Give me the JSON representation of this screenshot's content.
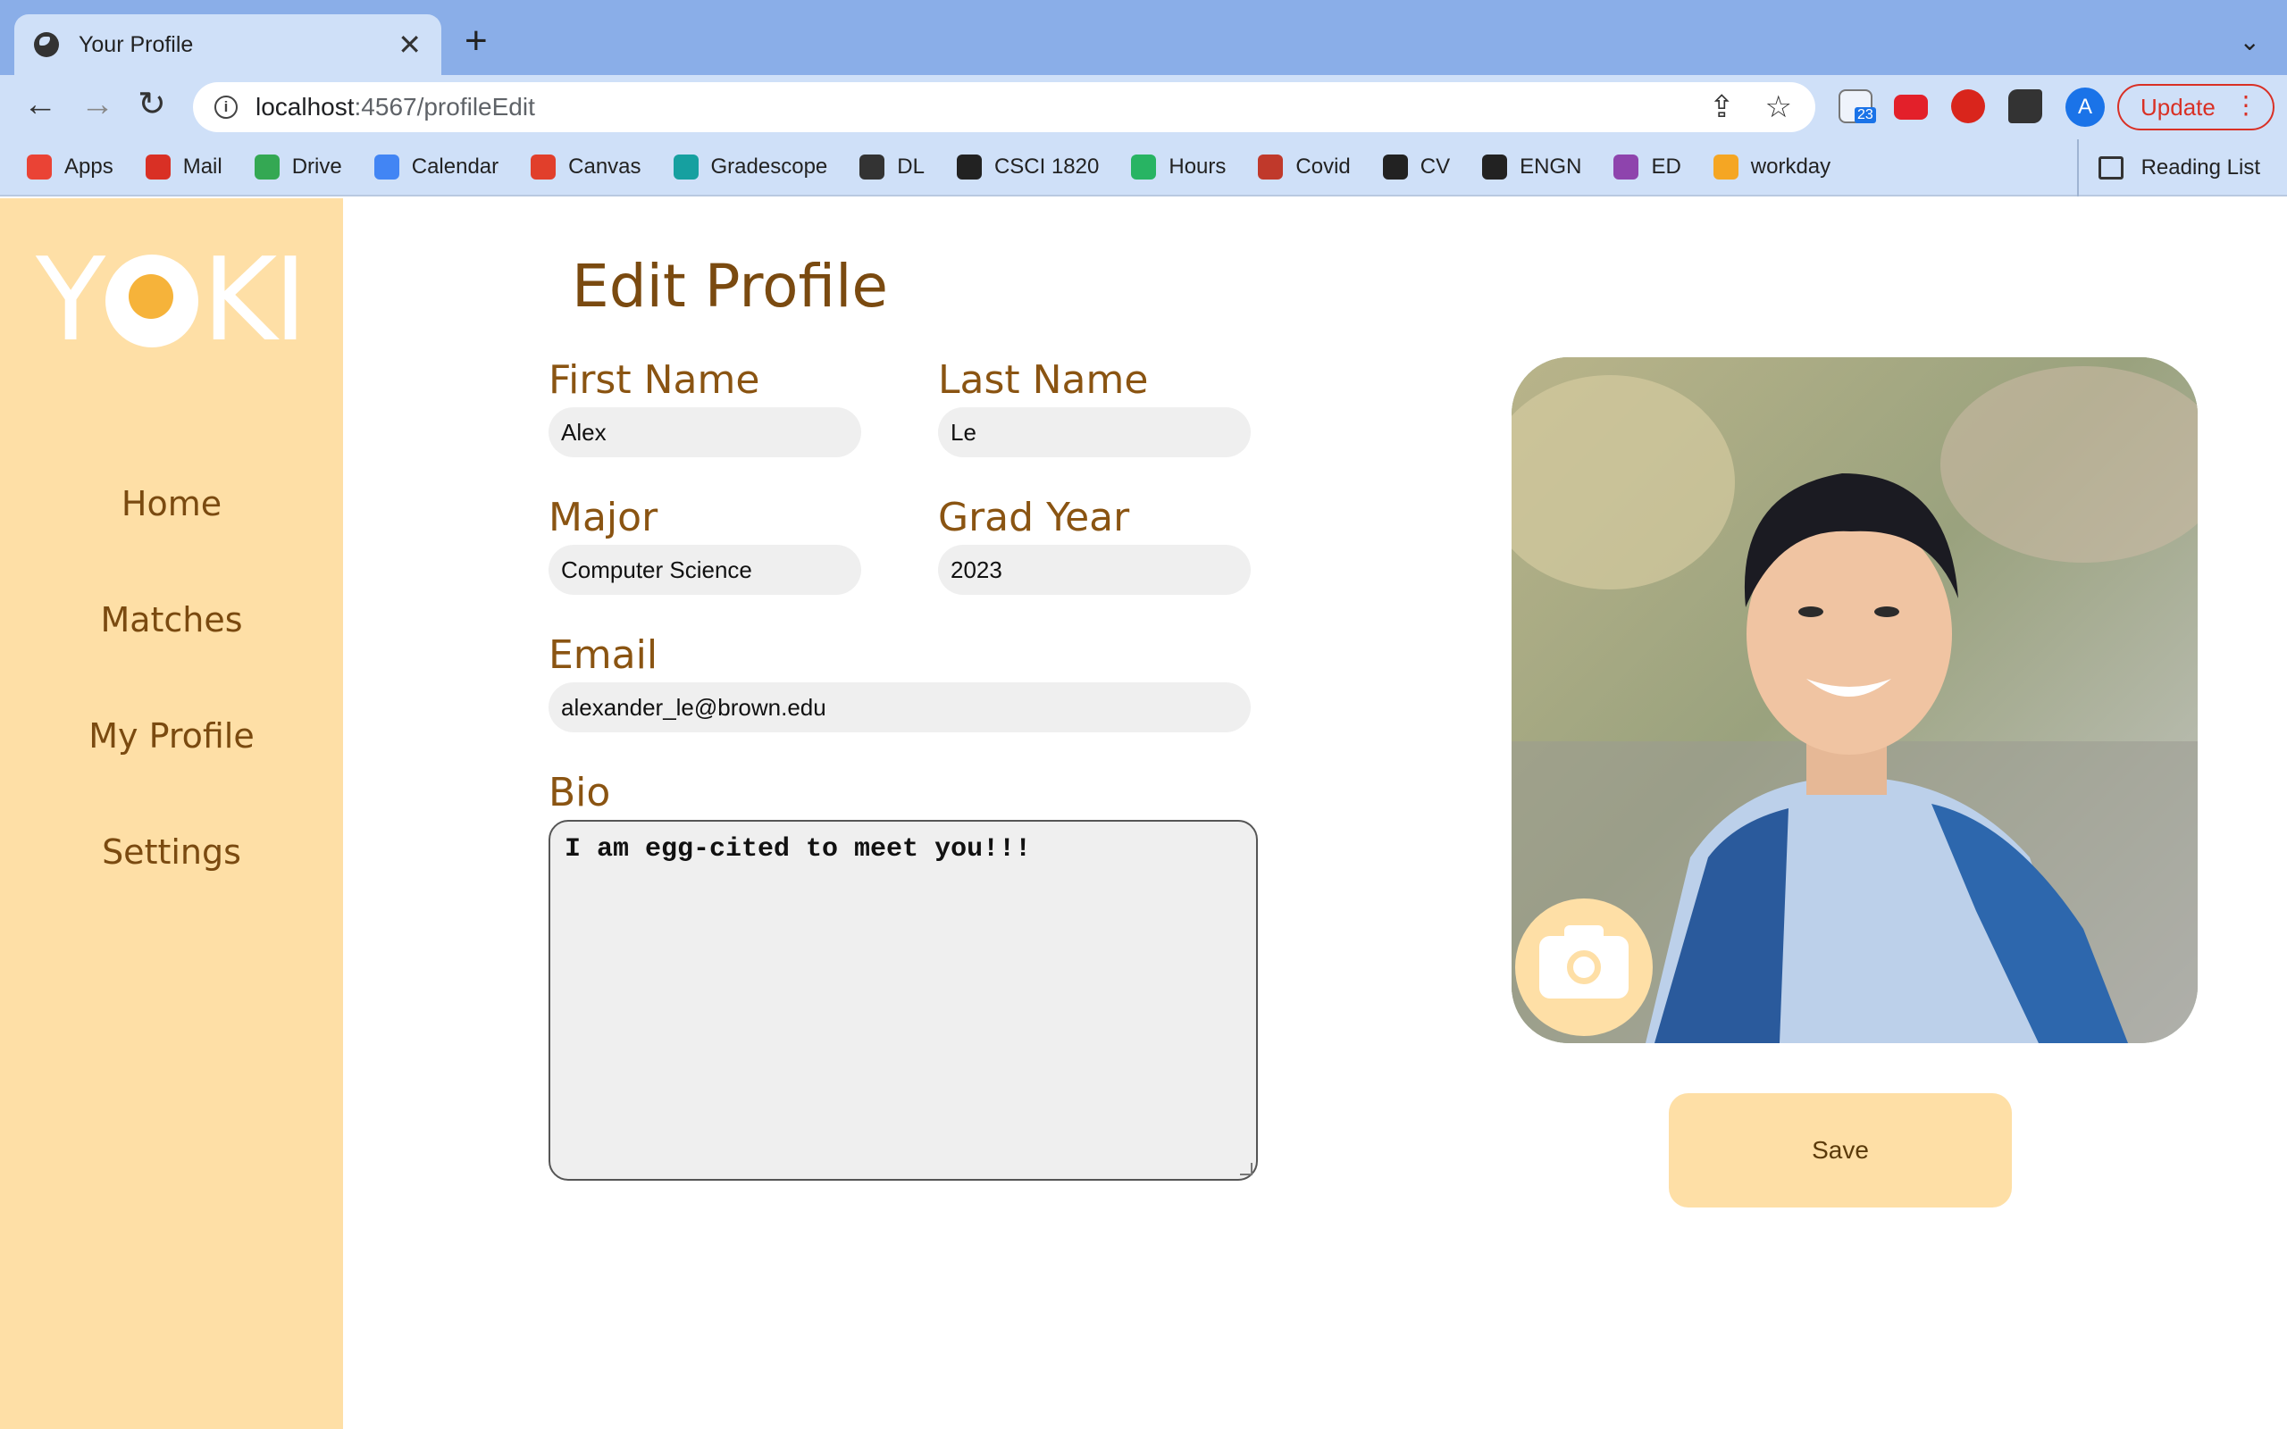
{
  "browser": {
    "tab_title": "Your Profile",
    "tab_close": "✕",
    "new_tab": "+",
    "tab_menu": "⌄",
    "url_host": "localhost",
    "url_path": ":4567/profileEdit",
    "avatar_letter": "A",
    "update_label": "Update",
    "mail_badge": "23",
    "reading_list": "Reading List",
    "bookmarks": [
      {
        "label": "Apps",
        "color": "#ea4335"
      },
      {
        "label": "Mail",
        "color": "#d93025"
      },
      {
        "label": "Drive",
        "color": "#34a853"
      },
      {
        "label": "Calendar",
        "color": "#4285f4"
      },
      {
        "label": "Canvas",
        "color": "#e13f2b"
      },
      {
        "label": "Gradescope",
        "color": "#16a0a0"
      },
      {
        "label": "DL",
        "color": "#333333"
      },
      {
        "label": "CSCI 1820",
        "color": "#222222"
      },
      {
        "label": "Hours",
        "color": "#28b463"
      },
      {
        "label": "Covid",
        "color": "#c0392b"
      },
      {
        "label": "CV",
        "color": "#222222"
      },
      {
        "label": "ENGN",
        "color": "#222222"
      },
      {
        "label": "ED",
        "color": "#8e44ad"
      },
      {
        "label": "workday",
        "color": "#f5a623"
      }
    ]
  },
  "sidebar": {
    "logo_left": "Y",
    "logo_right": "KI",
    "items": [
      {
        "label": "Home"
      },
      {
        "label": "Matches"
      },
      {
        "label": "My Profile"
      },
      {
        "label": "Settings"
      }
    ]
  },
  "form": {
    "title": "Edit Profile",
    "first_name_label": "First Name",
    "first_name": "Alex",
    "last_name_label": "Last Name",
    "last_name": "Le",
    "major_label": "Major",
    "major": "Computer Science",
    "grad_year_label": "Grad Year",
    "grad_year": "2023",
    "email_label": "Email",
    "email": "alexander_le@brown.edu",
    "bio_label": "Bio",
    "bio": "I am egg-cited to meet you!!!",
    "save_label": "Save"
  },
  "colors": {
    "sidebar_bg": "#fedfa6",
    "text_brown": "#7a4a10",
    "accent_yolk": "#f6b33a"
  }
}
